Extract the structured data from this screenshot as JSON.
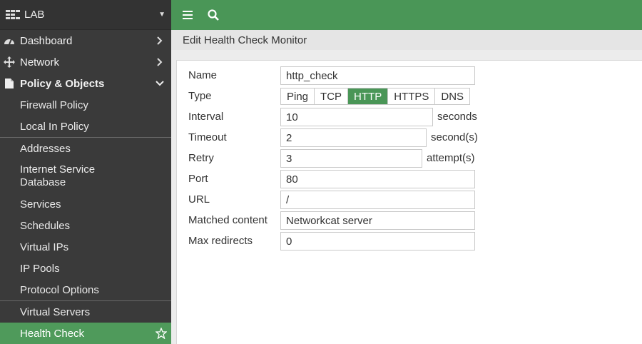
{
  "sidebar": {
    "header": {
      "title": "LAB"
    },
    "nav": [
      {
        "label": "Dashboard"
      },
      {
        "label": "Network"
      },
      {
        "label": "Policy & Objects"
      }
    ],
    "sub_items": [
      "Firewall Policy",
      "Local In Policy",
      "Addresses",
      "Internet Service Database",
      "Services",
      "Schedules",
      "Virtual IPs",
      "IP Pools",
      "Protocol Options",
      "Virtual Servers",
      "Health Check"
    ]
  },
  "content": {
    "title": "Edit Health Check Monitor"
  },
  "form": {
    "name": {
      "label": "Name",
      "value": "http_check"
    },
    "type": {
      "label": "Type",
      "options": [
        "Ping",
        "TCP",
        "HTTP",
        "HTTPS",
        "DNS"
      ],
      "selected": "HTTP"
    },
    "interval": {
      "label": "Interval",
      "value": "10",
      "unit": "seconds"
    },
    "timeout": {
      "label": "Timeout",
      "value": "2",
      "unit": "second(s)"
    },
    "retry": {
      "label": "Retry",
      "value": "3",
      "unit": "attempt(s)"
    },
    "port": {
      "label": "Port",
      "value": "80"
    },
    "url": {
      "label": "URL",
      "value": "/"
    },
    "matched_content": {
      "label": "Matched content",
      "value": "Networkcat server"
    },
    "max_redirects": {
      "label": "Max redirects",
      "value": "0"
    }
  },
  "colors": {
    "accent": "#4a9657",
    "sidebar_bg": "#3a3a3a",
    "active_item": "#4f9a5b"
  },
  "icons": [
    "fortigate-logo-icon",
    "dashboard-icon",
    "network-icon",
    "policy-icon",
    "menu-icon",
    "search-icon",
    "star-icon"
  ]
}
